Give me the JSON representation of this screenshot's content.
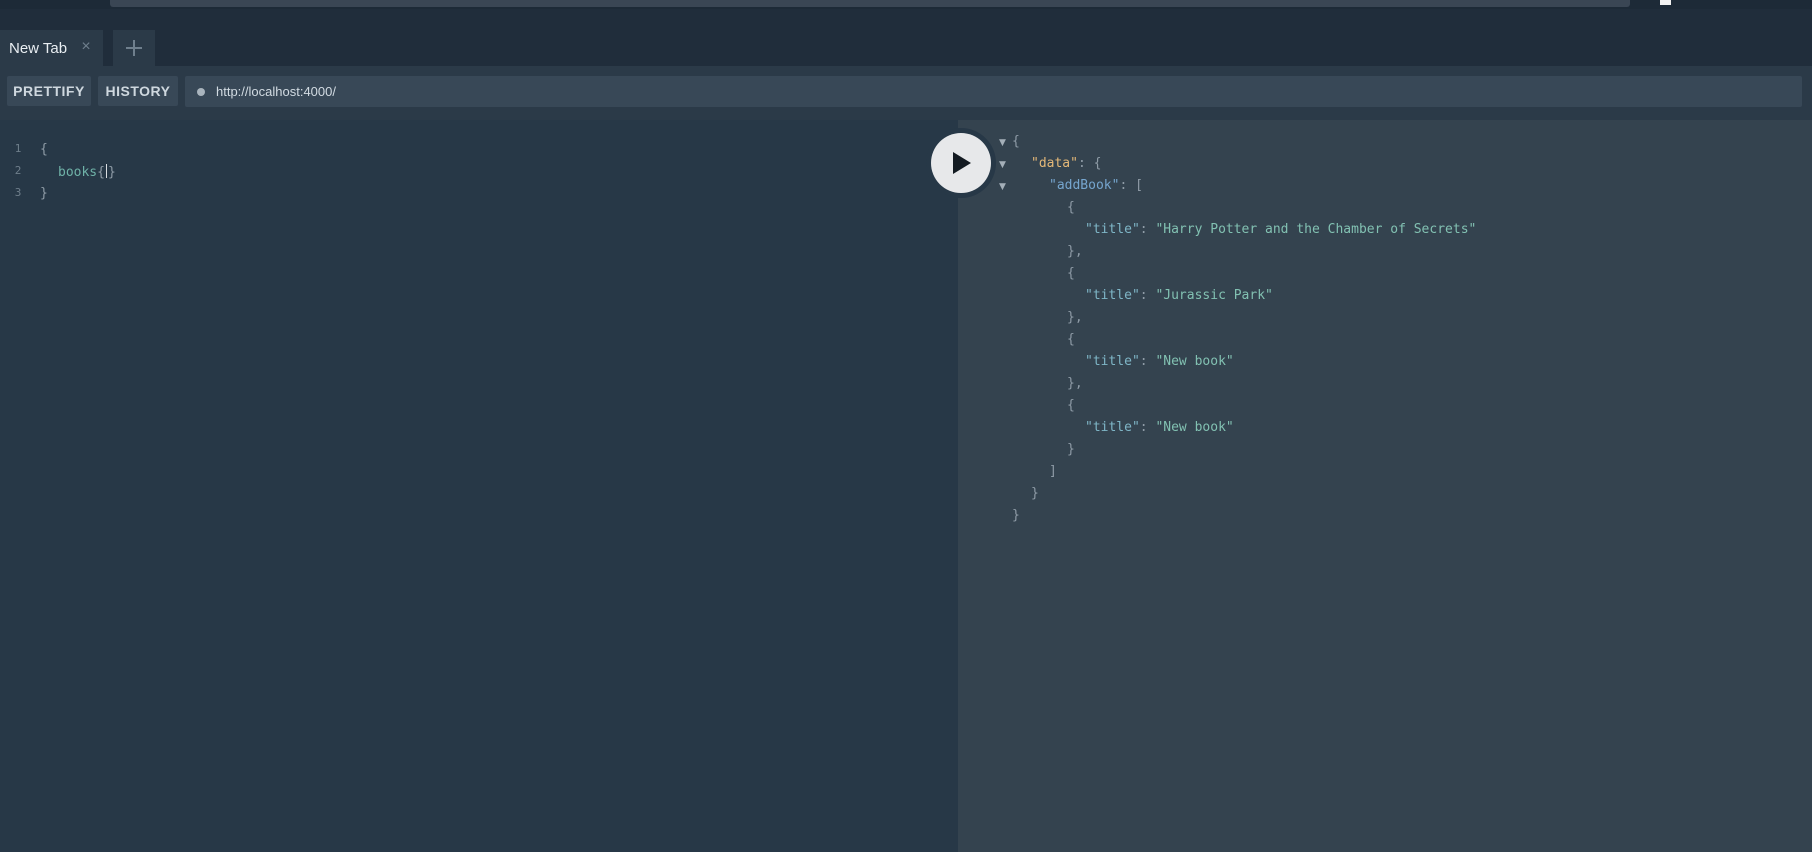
{
  "tabs": [
    {
      "label": "New Tab",
      "close_icon": "×"
    }
  ],
  "add_tab_icon": "+",
  "toolbar": {
    "prettify_label": "PRETTIFY",
    "history_label": "HISTORY",
    "url": "http://localhost:4000/"
  },
  "editor": {
    "line_numbers": [
      "1",
      "2",
      "3"
    ],
    "lines": {
      "open_brace": "{",
      "field": "books",
      "field_open": "{",
      "field_close": "}",
      "close_brace": "}"
    }
  },
  "result": {
    "open": "{",
    "data_key": "\"data\"",
    "data_sep": ": {",
    "addbook_key": "\"addBook\"",
    "addbook_sep": ": [",
    "title_key": "\"title\"",
    "colon": ": ",
    "obj_open": "{",
    "obj_close": "},",
    "obj_close_last": "}",
    "arr_close": "]",
    "data_close": "}",
    "close": "}",
    "titles": [
      "\"Harry Potter and the Chamber of Secrets\"",
      "\"Jurassic Park\"",
      "\"New book\"",
      "\"New book\""
    ]
  }
}
